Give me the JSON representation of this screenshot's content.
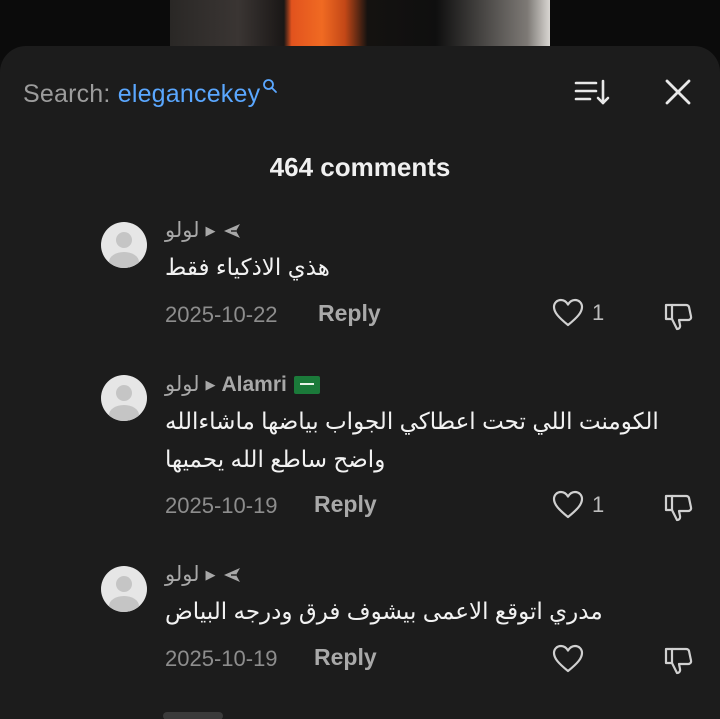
{
  "header": {
    "search_prefix": "Search:",
    "search_term": "elegancekey",
    "sort_icon": "sort-icon",
    "close_icon": "close-icon"
  },
  "comments_count": "464 comments",
  "comments": [
    {
      "author": "لولو",
      "target_icon": "paper-plane-icon",
      "text_lines": [
        "هذي الاذكياء فقط"
      ],
      "date": "2025-10-22",
      "reply_label": "Reply",
      "likes": "1"
    },
    {
      "author": "لولو",
      "reply_to": "Alamri",
      "target_icon": "saudi-flag-icon",
      "text_lines": [
        "الكومنت اللي تحت اعطاكي الجواب بياضها ماشاءالله",
        "واضح ساطع الله يحميها"
      ],
      "date": "2025-10-19",
      "reply_label": "Reply",
      "likes": "1"
    },
    {
      "author": "لولو",
      "target_icon": "paper-plane-icon",
      "text_lines": [
        "مدري اتوقع الاعمى بيشوف فرق ودرجه البياض"
      ],
      "date": "2025-10-19",
      "reply_label": "Reply",
      "likes": ""
    }
  ],
  "colors": {
    "sheet_bg": "#1c1c1c",
    "accent_link": "#5aa7ff",
    "muted_text": "#8d8d8d"
  }
}
